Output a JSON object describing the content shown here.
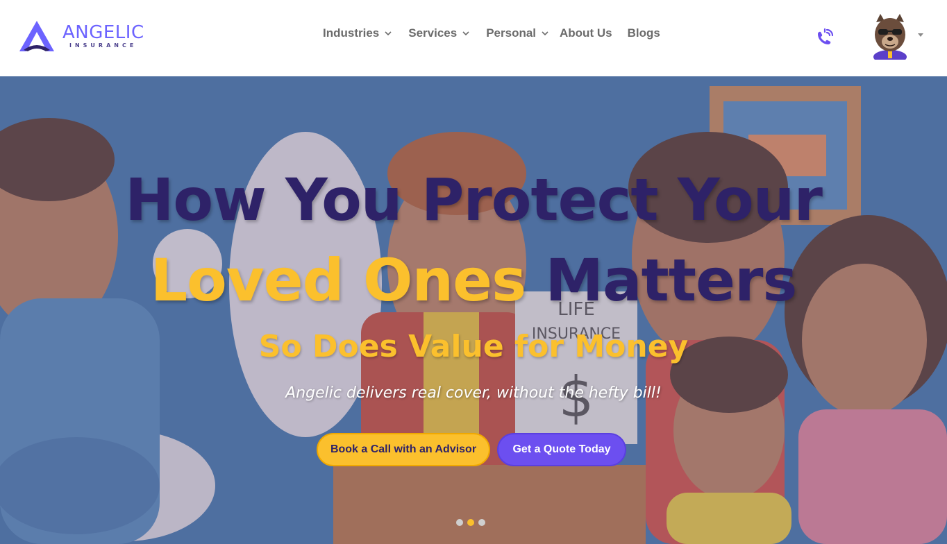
{
  "brand": {
    "name": "ANGELIC",
    "subtitle": "INSURANCE",
    "logo_icon": "angelic-a-logo",
    "primary_color": "#6c63ff",
    "navy_color": "#2e2268",
    "gold_color": "#fbc02d"
  },
  "nav": {
    "items": [
      {
        "label": "Industries",
        "has_dropdown": true
      },
      {
        "label": "Services",
        "has_dropdown": true
      },
      {
        "label": "Personal",
        "has_dropdown": true
      },
      {
        "label": "About Us",
        "has_dropdown": false
      },
      {
        "label": "Blogs",
        "has_dropdown": false
      }
    ],
    "phone_icon": "phone-ringing-icon",
    "avatar_icon": "mascot-avatar"
  },
  "hero": {
    "headline_line1": "How You Protect Your",
    "headline_line2_gold": "Loved Ones",
    "headline_line2_navy": "Matters",
    "subheadline": "So Does Value for Money",
    "tagline": "Angelic delivers real cover, without the hefty bill!",
    "background_sign_text": "LIFE INSURANCE $",
    "buttons": {
      "call": "Book a Call with an Advisor",
      "quote": "Get a Quote Today"
    },
    "carousel": {
      "total": 3,
      "active_index": 1
    }
  }
}
